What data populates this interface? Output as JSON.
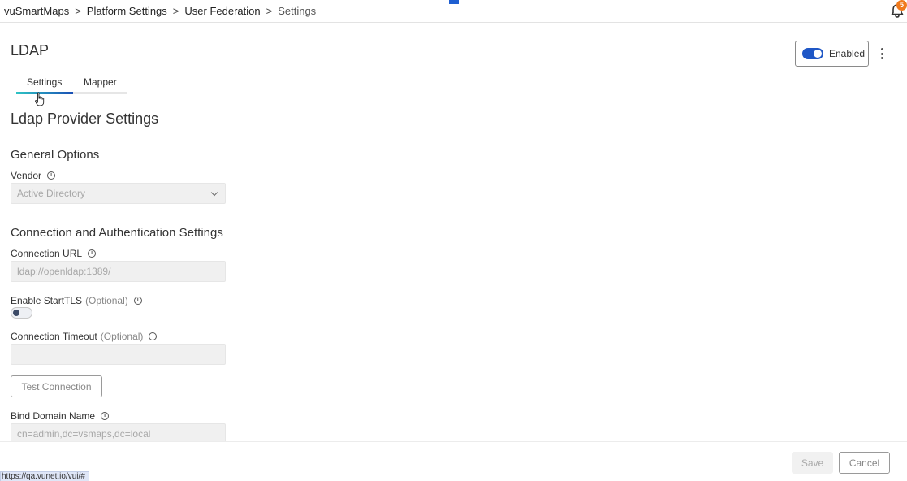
{
  "breadcrumb": [
    "vuSmartMaps",
    "Platform Settings",
    "User Federation",
    "Settings"
  ],
  "breadcrumb_separator": ">",
  "notifications": {
    "count": "5",
    "icon": "bell-icon",
    "badge_color": "#f07a1c"
  },
  "page": {
    "title": "LDAP"
  },
  "enabled_toggle": {
    "label": "Enabled",
    "on": true,
    "color": "#1f57c6"
  },
  "tabs": [
    {
      "label": "Settings",
      "active": true
    },
    {
      "label": "Mapper",
      "active": false
    }
  ],
  "section_title": "Ldap Provider Settings",
  "general": {
    "title": "General Options",
    "vendor": {
      "label": "Vendor",
      "value": "Active Directory"
    }
  },
  "connection": {
    "title": "Connection and Authentication Settings",
    "url": {
      "label": "Connection URL",
      "placeholder": "ldap://openldap:1389/"
    },
    "starttls": {
      "label": "Enable StartTLS",
      "optional": "(Optional)",
      "on": false
    },
    "timeout": {
      "label": "Connection Timeout",
      "optional": "(Optional)",
      "value": ""
    },
    "test_button": "Test Connection",
    "bind_dn": {
      "label": "Bind Domain Name",
      "placeholder": "cn=admin,dc=vsmaps,dc=local"
    }
  },
  "footer": {
    "save": "Save",
    "cancel": "Cancel"
  },
  "status_url": "https://qa.vunet.io/vui/#"
}
